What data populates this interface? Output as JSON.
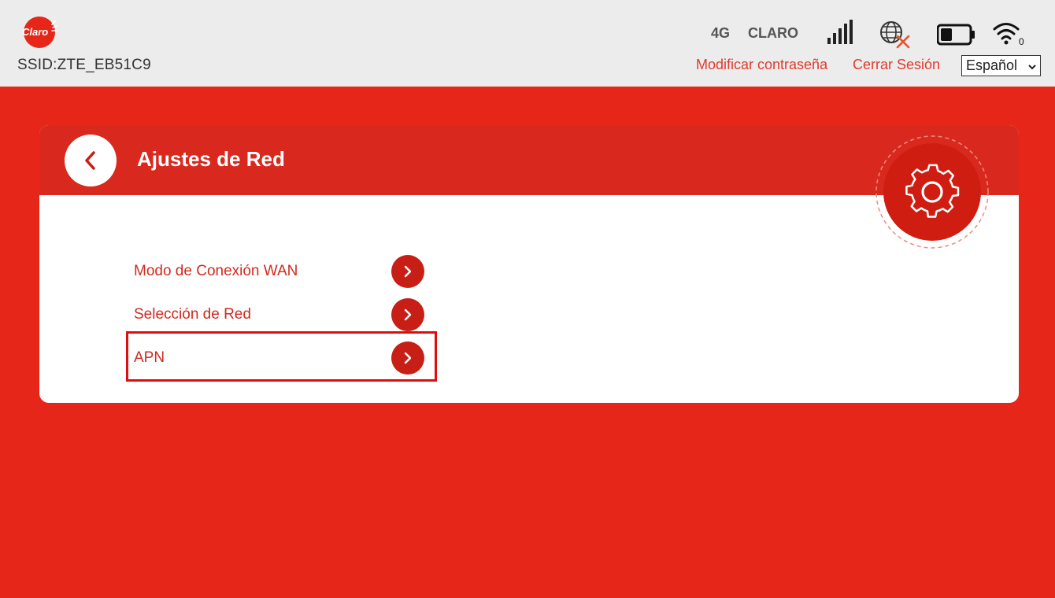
{
  "header": {
    "ssid": "SSID:ZTE_EB51C9",
    "network_type": "4G",
    "carrier": "CLARO",
    "wifi_clients": "0",
    "change_password_link": "Modificar contraseña",
    "logout_link": "Cerrar Sesión",
    "language": "Español",
    "logo_text": "Claro"
  },
  "card": {
    "title": "Ajustes de Red",
    "items": [
      {
        "label": "Modo de Conexión WAN"
      },
      {
        "label": "Selección de Red"
      },
      {
        "label": "APN"
      }
    ],
    "highlighted_item": "APN"
  },
  "icons": {
    "back": "chevron-left-icon",
    "item_arrow": "chevron-right-icon",
    "settings": "gear-icon",
    "signal": "signal-bars-icon",
    "internet": "globe-disconnected-icon",
    "battery": "battery-icon",
    "wifi": "wifi-icon"
  },
  "colors": {
    "brand_red": "#e52619",
    "header_red": "#d9291f",
    "link_red": "#e03a2c",
    "topbar_gray": "#ececec",
    "disconnected_orange": "#e8542a"
  }
}
